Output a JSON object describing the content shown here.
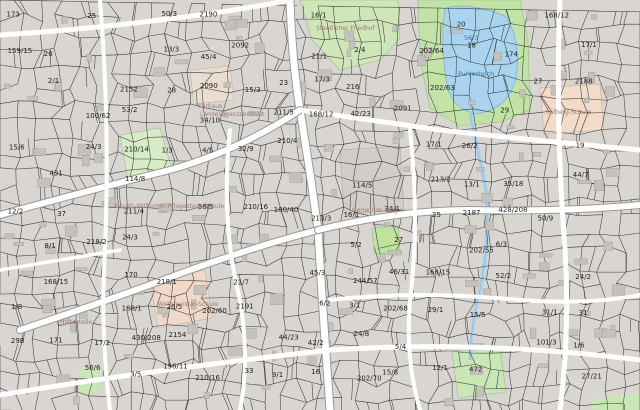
{
  "map": {
    "colors": {
      "background": "#d9d6d2",
      "parcel_line": "#3a3a3a",
      "road": "#ffffff",
      "green": "#c9e7b4",
      "park": "#d7ecc6",
      "water": "#aad3f0",
      "water_text": "#3d73a8",
      "poi_text": "#9a7b72",
      "label_text": "#222222"
    },
    "water_labels": [
      "56/3",
      "Pulverteich"
    ],
    "poi_labels": [
      "Staatlicher Friedhof",
      "Kurhaus",
      "Landesfinanzzentrum",
      "Berufs-Willkomm-Pflegestern-Schule",
      "Haltestelle",
      "Wehrmeister-Schule",
      "Salberg-Schule",
      "Gemeinde-Weg"
    ],
    "parcel_labels": [
      "2092",
      "202/60",
      "202/63",
      "202/64",
      "2091",
      "202/70",
      "202/68",
      "2090",
      "202/55",
      "2152",
      "2154",
      "2187",
      "2188",
      "2190",
      "2191",
      "431",
      "430/208",
      "428/208",
      "210/14",
      "210/16",
      "213/3",
      "218/1",
      "218/2",
      "21/1",
      "211/4",
      "211/5",
      "210/4",
      "17/2",
      "17/3",
      "16/1",
      "13/3",
      "24/3",
      "26/2",
      "24/2",
      "26/5",
      "29/1",
      "31/1",
      "32/9",
      "168/12",
      "168/15",
      "213/2",
      "196/11",
      "168/1",
      "1/6",
      "1/8",
      "1/3",
      "3/5",
      "5/4",
      "4/5",
      "6/2",
      "6/3",
      "9/1",
      "19",
      "23",
      "25",
      "27",
      "31",
      "33",
      "37",
      "50/3",
      "44/23",
      "45/3",
      "45/4",
      "42/2",
      "44/7",
      "34/1",
      "16",
      "18",
      "20",
      "21/7",
      "298",
      "50/9",
      "114/8",
      "114/5",
      "2/4",
      "56/6",
      "56/5",
      "12/2",
      "12/1",
      "17/1",
      "173",
      "174",
      "171",
      "170",
      "27",
      "28",
      "29",
      "26",
      "25",
      "100/40",
      "100/62",
      "52/2",
      "53/2",
      "42/23",
      "46/31",
      "13/1",
      "35/18",
      "34/10",
      "101/3",
      "210/16",
      "24/8",
      "24/3",
      "27/21",
      "2/1",
      "8/1",
      "5/2",
      "3/1",
      "159/15",
      "472",
      "168/12",
      "168/15",
      "244/57",
      "216",
      "16/1",
      "15/5",
      "15/6",
      "15/8",
      "15/3",
      "17/1"
    ]
  }
}
